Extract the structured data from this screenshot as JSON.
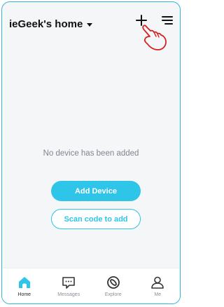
{
  "header": {
    "home_name": "ieGeek's home"
  },
  "main": {
    "empty_message": "No device has been added",
    "add_device_label": "Add Device",
    "scan_label": "Scan code to add"
  },
  "tabs": [
    {
      "label": "Home",
      "icon": "home-icon",
      "active": true
    },
    {
      "label": "Messages",
      "icon": "message-icon",
      "active": false
    },
    {
      "label": "Explore",
      "icon": "explore-icon",
      "active": false
    },
    {
      "label": "Me",
      "icon": "user-icon",
      "active": false
    }
  ],
  "colors": {
    "accent": "#2ec5e8",
    "frame": "#36b1d8",
    "pointer_hand": "#d32020"
  }
}
